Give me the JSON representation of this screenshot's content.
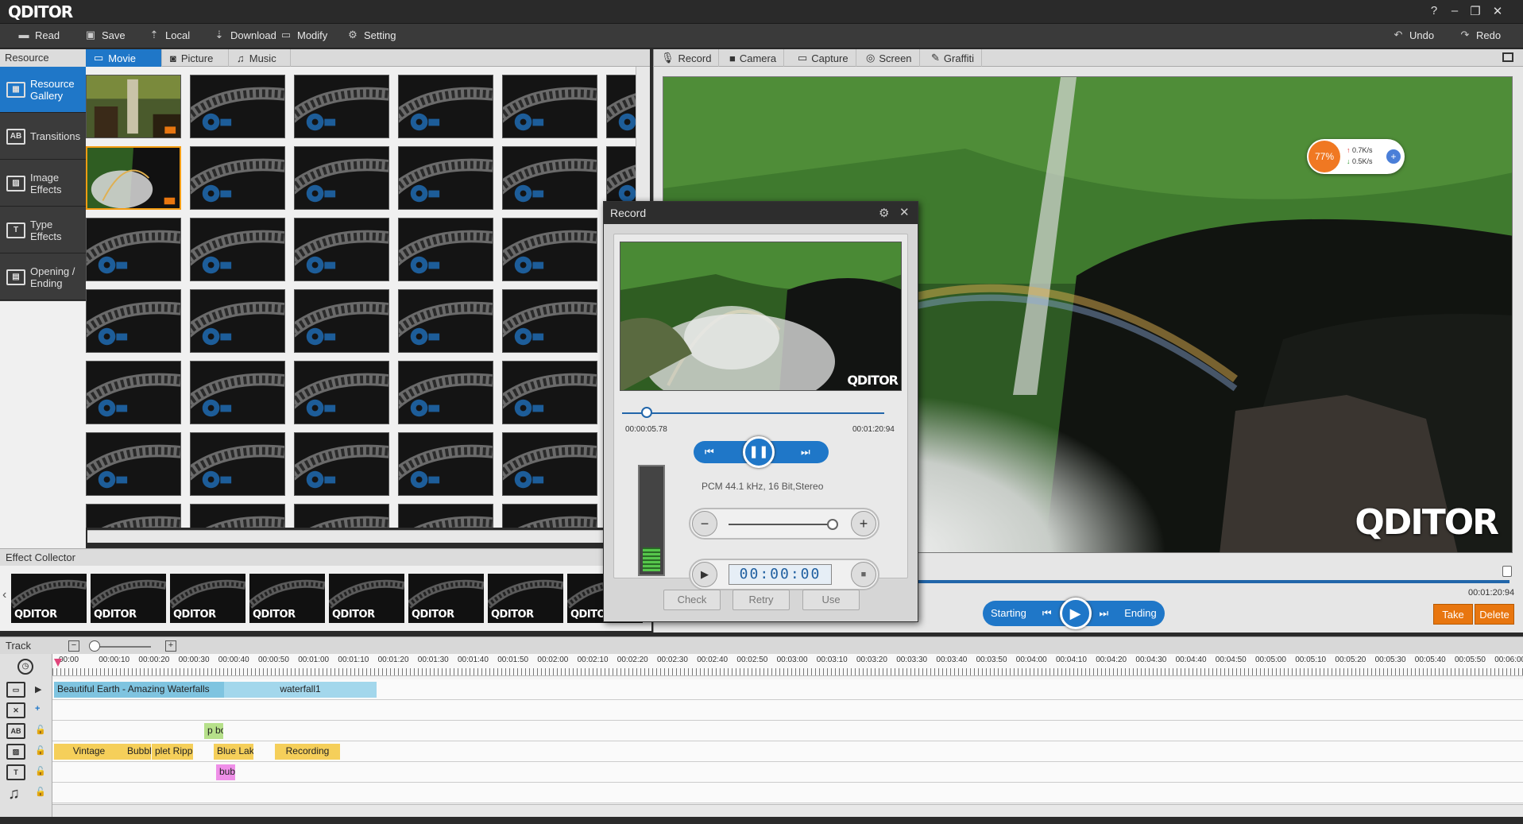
{
  "app": {
    "logo": "QDITOR"
  },
  "window_controls": {
    "help": "?",
    "minimize": "–",
    "restore": "❐",
    "close": "✕"
  },
  "menu": {
    "read": "Read",
    "save": "Save",
    "local": "Local",
    "download": "Download",
    "modify": "Modify",
    "setting": "Setting",
    "undo": "Undo",
    "redo": "Redo"
  },
  "resource": {
    "header": "Resource",
    "tabs": [
      "Movie",
      "Picture",
      "Music"
    ],
    "active_tab": "Movie"
  },
  "sidebar": {
    "items": [
      {
        "label1": "Resource",
        "label2": "Gallery",
        "icon": "gallery-icon"
      },
      {
        "label1": "Transitions",
        "label2": "",
        "icon": "transitions-icon"
      },
      {
        "label1": "Image",
        "label2": "Effects",
        "icon": "image-effects-icon"
      },
      {
        "label1": "Type",
        "label2": "Effects",
        "icon": "type-effects-icon"
      },
      {
        "label1": "Opening /",
        "label2": "Ending",
        "icon": "opening-ending-icon"
      }
    ]
  },
  "effect_collector": {
    "label": "Effect Collector",
    "item_text": "QDITOR"
  },
  "capture_tabs": [
    "Record",
    "Camera",
    "Capture",
    "Screen",
    "Graffiti"
  ],
  "preview": {
    "logo": "QDITOR",
    "speed": {
      "percent": "77%",
      "up": "0.7K/s",
      "down": "0.5K/s"
    },
    "time": "00:01:20:94",
    "controls": {
      "starting": "Starting",
      "ending": "Ending"
    },
    "take": "Take",
    "delete": "Delete"
  },
  "record_dialog": {
    "title": "Record",
    "elapsed": "00:00:05.78",
    "total": "00:01:20:94",
    "audio_format": "PCM 44.1 kHz, 16 Bit,Stereo",
    "counter": "00:00:00",
    "buttons": {
      "check": "Check",
      "retry": "Retry",
      "use": "Use"
    },
    "video_logo": "QDITOR"
  },
  "track": {
    "label": "Track",
    "ruler": [
      "00:00",
      "00:00:10",
      "00:00:20",
      "00:00:30",
      "00:00:40",
      "00:00:50",
      "00:01:00",
      "00:01:10",
      "00:01:20",
      "00:01:30",
      "00:01:40",
      "00:01:50",
      "00:02:00",
      "00:02:10",
      "00:02:20",
      "00:02:30",
      "00:02:40",
      "00:02:50",
      "00:03:00",
      "00:03:10",
      "00:03:20",
      "00:03:30",
      "00:03:40",
      "00:03:50",
      "00:04:00",
      "00:04:10",
      "00:04:20",
      "00:04:30",
      "00:04:40",
      "00:04:50",
      "00:05:00",
      "00:05:10",
      "00:05:20",
      "00:05:30",
      "00:05:40",
      "00:05:50",
      "00:06:00"
    ],
    "video_clips": [
      "Beautiful Earth - Amazing Waterfalls",
      "waterfall1"
    ],
    "transition_clip": "p bo",
    "effect_clips": [
      "Vintage",
      "Bubble",
      "plet Ripp",
      "Blue Lake",
      "Recording"
    ],
    "type_clip": "bub"
  },
  "colors": {
    "accent": "#1f77c8",
    "orange": "#e8760f"
  }
}
